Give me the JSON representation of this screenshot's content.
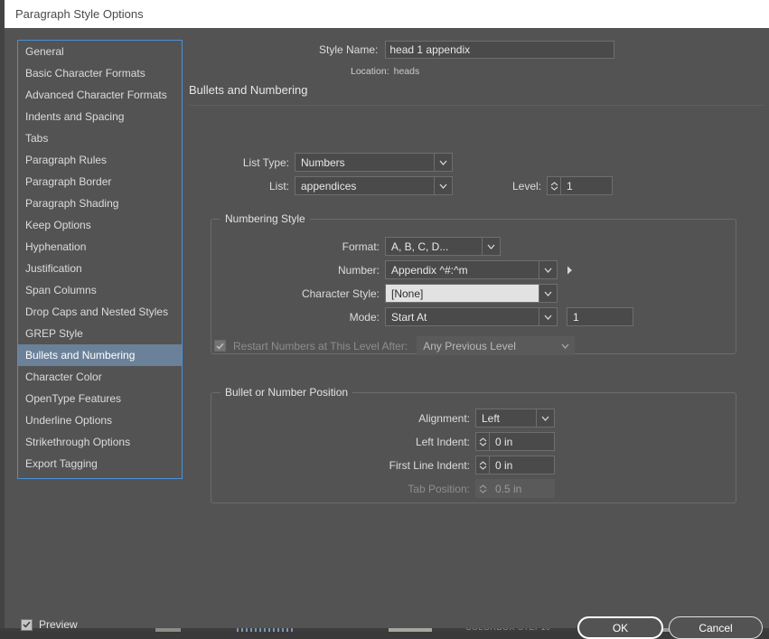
{
  "window": {
    "title": "Paragraph Style Options"
  },
  "sidebar": {
    "items": [
      {
        "label": "General",
        "selected": false
      },
      {
        "label": "Basic Character Formats",
        "selected": false
      },
      {
        "label": "Advanced Character Formats",
        "selected": false
      },
      {
        "label": "Indents and Spacing",
        "selected": false
      },
      {
        "label": "Tabs",
        "selected": false
      },
      {
        "label": "Paragraph Rules",
        "selected": false
      },
      {
        "label": "Paragraph Border",
        "selected": false
      },
      {
        "label": "Paragraph Shading",
        "selected": false
      },
      {
        "label": "Keep Options",
        "selected": false
      },
      {
        "label": "Hyphenation",
        "selected": false
      },
      {
        "label": "Justification",
        "selected": false
      },
      {
        "label": "Span Columns",
        "selected": false
      },
      {
        "label": "Drop Caps and Nested Styles",
        "selected": false
      },
      {
        "label": "GREP Style",
        "selected": false
      },
      {
        "label": "Bullets and Numbering",
        "selected": true
      },
      {
        "label": "Character Color",
        "selected": false
      },
      {
        "label": "OpenType Features",
        "selected": false
      },
      {
        "label": "Underline Options",
        "selected": false
      },
      {
        "label": "Strikethrough Options",
        "selected": false
      },
      {
        "label": "Export Tagging",
        "selected": false
      }
    ]
  },
  "header": {
    "style_name_label": "Style Name:",
    "style_name_value": "head 1 appendix",
    "location_label": "Location:",
    "location_value": "heads",
    "section_heading": "Bullets and Numbering"
  },
  "list_settings": {
    "list_type_label": "List Type:",
    "list_type_value": "Numbers",
    "list_label": "List:",
    "list_value": "appendices",
    "level_label": "Level:",
    "level_value": "1"
  },
  "numbering_style": {
    "group_title": "Numbering Style",
    "format_label": "Format:",
    "format_value": "A, B, C, D...",
    "number_label": "Number:",
    "number_value": "Appendix ^#:^m",
    "insert_special_icon": "play-triangle-icon",
    "character_style_label": "Character Style:",
    "character_style_value": "[None]",
    "mode_label": "Mode:",
    "mode_value": "Start At",
    "mode_start_value": "1",
    "restart_label": "Restart Numbers at This Level After:",
    "restart_checked": true,
    "restart_enabled": false,
    "restart_value": "Any Previous Level"
  },
  "position": {
    "group_title": "Bullet or Number Position",
    "alignment_label": "Alignment:",
    "alignment_value": "Left",
    "left_indent_label": "Left Indent:",
    "left_indent_value": "0 in",
    "first_line_indent_label": "First Line Indent:",
    "first_line_indent_value": "0 in",
    "tab_position_label": "Tab Position:",
    "tab_position_value": "0.5 in",
    "tab_position_enabled": false
  },
  "footer": {
    "preview_label": "Preview",
    "preview_checked": true,
    "ok_label": "OK",
    "cancel_label": "Cancel"
  },
  "colors": {
    "dialog_bg": "#535353",
    "titlebar_bg": "#ffffff",
    "selection_bg": "#6a8199",
    "focus_border": "#4a90d9",
    "field_bg": "#4a4a4a",
    "light_field_bg": "#e2e2e2"
  }
}
